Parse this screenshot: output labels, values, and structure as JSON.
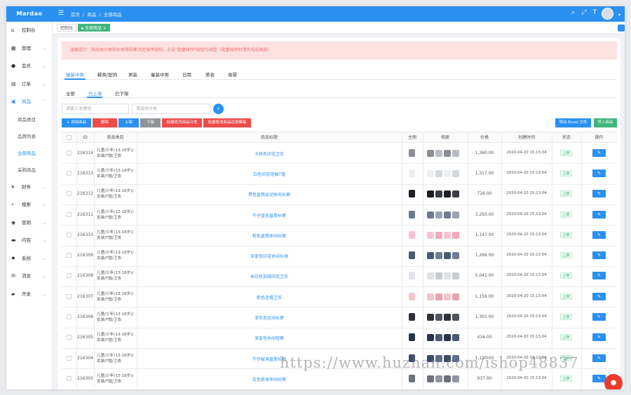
{
  "app": {
    "logo": "Mardao"
  },
  "topbar": {
    "breadcrumbs": [
      "首页",
      "商品",
      "全部商品"
    ],
    "separator": "/"
  },
  "sidebar": {
    "items": [
      {
        "label": "控制台",
        "icon": "home-icon"
      },
      {
        "label": "管理",
        "icon": "grid-icon"
      },
      {
        "label": "会员",
        "icon": "user-icon"
      },
      {
        "label": "订单",
        "icon": "order-icon"
      },
      {
        "label": "商品",
        "icon": "goods-icon"
      },
      {
        "label": "财务",
        "icon": "yen-icon"
      },
      {
        "label": "搜索",
        "icon": "search-icon"
      },
      {
        "label": "营销",
        "icon": "marketing-icon"
      },
      {
        "label": "内容",
        "icon": "content-icon"
      },
      {
        "label": "系统",
        "icon": "gear-icon"
      },
      {
        "label": "消息",
        "icon": "message-icon"
      },
      {
        "label": "开发",
        "icon": "briefcase-icon"
      }
    ],
    "sub_items": [
      {
        "label": "商品类目"
      },
      {
        "label": "品牌列表"
      },
      {
        "label": "全部商品"
      },
      {
        "label": "采购商品"
      }
    ]
  },
  "page_tabs": {
    "console": "控制台",
    "current": "全部商品"
  },
  "alert": {
    "text": "温馨提示：商品由分类和价格等因素决定排序规则，点击\"批量排序\"按钮可调整（批量排序时请先勾选商品）"
  },
  "type_tabs": [
    "服装中类",
    "鞋类/配饰",
    "男装",
    "童装中类",
    "日用",
    "美妆",
    "母婴"
  ],
  "status_tabs": [
    "全部",
    "已上架",
    "已下架"
  ],
  "search": {
    "keyword_placeholder": "请输入关键词",
    "category_placeholder": "请选择分类"
  },
  "actions": {
    "add": "+ 添加商品",
    "delete": "删除",
    "on_shelf": "上架",
    "off_shelf": "下架",
    "batch_category": "批量修改商品分类",
    "batch_freight": "批量修改商品运费模板",
    "export": "导出 Excel 文件",
    "import": "导入商品"
  },
  "table": {
    "headers": [
      "",
      "ID",
      "商品类目",
      "商品标题",
      "主图",
      "相册",
      "价格",
      "创建时间",
      "状态",
      "操作"
    ],
    "status_label": "上架",
    "edit_label": "✎",
    "rows": [
      {
        "id": "216314",
        "category": "儿童/少年(13-18岁)/女装/T恤/卫衣",
        "title": "卡其色印花卫衣",
        "price": "1,360.00",
        "created": "2020-04-20 15:13:04"
      },
      {
        "id": "216313",
        "category": "儿童/少年(13-18岁)/女装/T恤/卫衣",
        "title": "白色印花短袖T恤",
        "price": "1,317.00",
        "created": "2020-04-20 15:13:04"
      },
      {
        "id": "216312",
        "category": "儿童/少年(13-18岁)/女装/T恤/卫衣",
        "title": "黑色直筒运动休闲长裤",
        "price": "726.00",
        "created": "2020-04-20 15:13:04"
      },
      {
        "id": "216311",
        "category": "儿童/少年(13-18岁)/女装/T恤/卫衣",
        "title": "牛仔蓝色直筒长裤",
        "price": "3,293.00",
        "created": "2020-04-20 15:13:04"
      },
      {
        "id": "216310",
        "category": "儿童/少年(13-18岁)/女装/T恤/卫衣",
        "title": "粉色直筒休闲长裤",
        "price": "1,147.00",
        "created": "2020-04-20 15:13:04"
      },
      {
        "id": "216309",
        "category": "儿童/少年(13-18岁)/女装/T恤/卫衣",
        "title": "深蓝色印花休闲长袖",
        "price": "1,266.00",
        "created": "2020-04-20 15:13:04"
      },
      {
        "id": "216308",
        "category": "儿童/少年(13-18岁)/女装/T恤/卫衣",
        "title": "米白色加绒印花卫衣",
        "price": "5,041.00",
        "created": "2020-04-20 15:13:04"
      },
      {
        "id": "216307",
        "category": "儿童/少年(13-18岁)/女装/T恤/卫衣",
        "title": "粉色连帽卫衣",
        "price": "1,156.00",
        "created": "2020-04-20 15:13:04"
      },
      {
        "id": "216306",
        "category": "儿童/少年(13-18岁)/女装/T恤/卫衣",
        "title": "深灰色运动长裤",
        "price": "1,301.00",
        "created": "2020-04-20 15:13:04"
      },
      {
        "id": "216305",
        "category": "儿童/少年(13-18岁)/女装/T恤/卫衣",
        "title": "深蓝色休闲短裤",
        "price": "416.00",
        "created": "2020-04-20 15:13:04"
      },
      {
        "id": "216304",
        "category": "儿童/少年(13-18岁)/女装/T恤/卫衣",
        "title": "牛仔破洞直筒长裤",
        "price": "1,120.00",
        "created": "2020-04-20 15:13:04"
      },
      {
        "id": "216303",
        "category": "儿童/少年(13-18岁)/女装/T恤/卫衣",
        "title": "灰色修身休闲长裤",
        "price": "937.00",
        "created": "2020-04-20 15:13:04"
      }
    ]
  },
  "watermark": "https://www.huzhan.com/ishop48837",
  "colors": {
    "primary": "#2b91f0",
    "success": "#3fb57d",
    "danger": "#ee4b4b",
    "gray": "#909399"
  }
}
